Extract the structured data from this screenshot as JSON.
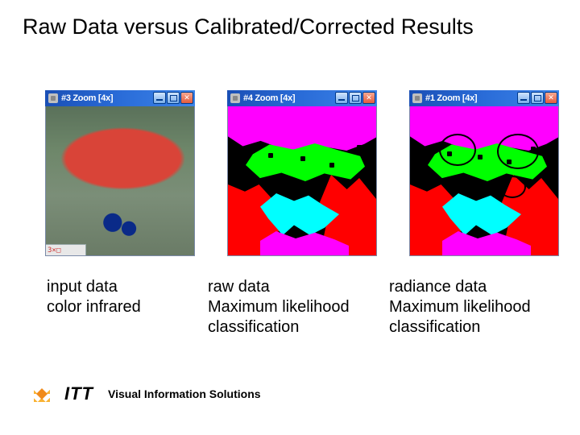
{
  "title": "Raw Data versus Calibrated/Corrected Results",
  "panels": [
    {
      "window_title": "#3 Zoom [4x]",
      "status": "3×□"
    },
    {
      "window_title": "#4 Zoom [4x]"
    },
    {
      "window_title": "#1 Zoom [4x]"
    }
  ],
  "captions": {
    "c1_l1": "input data",
    "c1_l2": "color infrared",
    "c2_l1": "raw data",
    "c2_l2": "Maximum likelihood",
    "c2_l3": "classification",
    "c3_l1": "radiance data",
    "c3_l2": "Maximum likelihood",
    "c3_l3": "classification"
  },
  "footer": {
    "brand": "ITT",
    "tagline": "Visual Information Solutions"
  }
}
